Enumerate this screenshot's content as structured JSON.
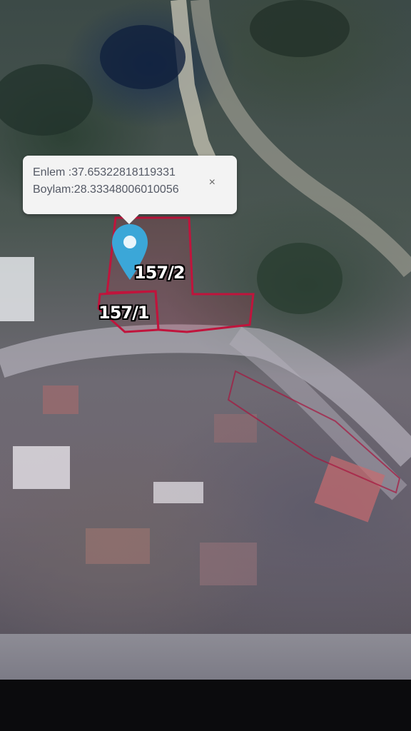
{
  "map": {
    "view": "satellite",
    "parcel_color": "#c0143c",
    "marker_color": "#3ba7d8"
  },
  "popup": {
    "latitude_line": "Enlem :37.65322818119331",
    "longitude_line": "Boylam:28.33348006010056",
    "close_symbol": "×"
  },
  "parcels": [
    {
      "label": "157/2"
    },
    {
      "label": "157/1"
    }
  ]
}
